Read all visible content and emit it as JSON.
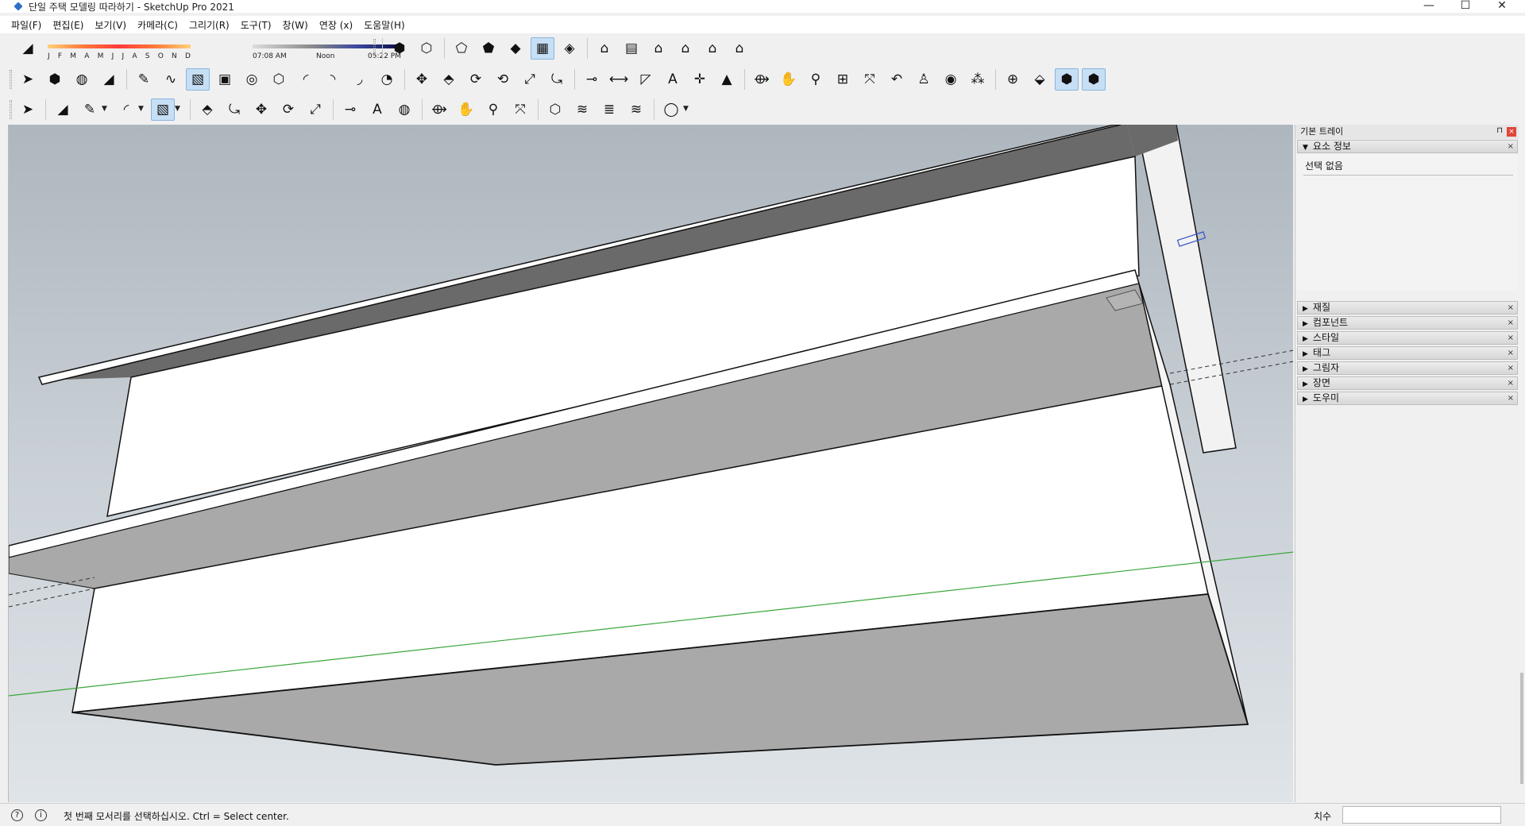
{
  "window": {
    "title": "단일 주택 모델링 따라하기 - SketchUp Pro 2021",
    "minimize": "—",
    "maximize": "☐",
    "close": "✕"
  },
  "menu": [
    "파일(F)",
    "편집(E)",
    "보기(V)",
    "카메라(C)",
    "그리기(R)",
    "도구(T)",
    "창(W)",
    "연장 (x)",
    "도움말(H)"
  ],
  "shadow": {
    "months": [
      "J",
      "F",
      "M",
      "A",
      "M",
      "J",
      "J",
      "A",
      "S",
      "O",
      "N",
      "D"
    ],
    "time_start": "07:08 AM",
    "time_mid": "Noon",
    "time_end": "05:22 PM"
  },
  "toolbar_rows": [
    [
      {
        "name": "eraser-icon",
        "glyph": "◢"
      },
      {
        "name": "xray-style-icon",
        "glyph": "⬢"
      },
      {
        "name": "back-edges-icon",
        "glyph": "⬡"
      },
      {
        "name": "wireframe-icon",
        "glyph": "⬠"
      },
      {
        "name": "hidden-line-icon",
        "glyph": "⬟"
      },
      {
        "name": "shaded-icon",
        "glyph": "◆"
      },
      {
        "name": "shaded-textures-icon",
        "glyph": "▦",
        "active": true
      },
      {
        "name": "monochrome-icon",
        "glyph": "◈"
      },
      {
        "name": "iso-view-icon",
        "glyph": "⌂"
      },
      {
        "name": "top-view-icon",
        "glyph": "▤"
      },
      {
        "name": "front-view-icon",
        "glyph": "⌂"
      },
      {
        "name": "right-view-icon",
        "glyph": "⌂"
      },
      {
        "name": "back-view-icon",
        "glyph": "⌂"
      },
      {
        "name": "left-view-icon",
        "glyph": "⌂"
      }
    ],
    [
      {
        "name": "select-icon",
        "glyph": "➤"
      },
      {
        "name": "component-icon",
        "glyph": "⬢"
      },
      {
        "name": "paint-bucket-icon",
        "glyph": "◍"
      },
      {
        "name": "eraser-icon",
        "glyph": "◢"
      },
      {
        "name": "pencil-icon",
        "glyph": "✎"
      },
      {
        "name": "freehand-icon",
        "glyph": "∿"
      },
      {
        "name": "rectangle-icon",
        "glyph": "▧",
        "active": true
      },
      {
        "name": "rotated-rect-icon",
        "glyph": "▣"
      },
      {
        "name": "circle-icon",
        "glyph": "◎"
      },
      {
        "name": "polygon-icon",
        "glyph": "⬡"
      },
      {
        "name": "arc-icon",
        "glyph": "◜"
      },
      {
        "name": "arc2-icon",
        "glyph": "◝"
      },
      {
        "name": "arc3-icon",
        "glyph": "◞"
      },
      {
        "name": "pie-icon",
        "glyph": "◔"
      },
      {
        "name": "move-icon",
        "glyph": "✥"
      },
      {
        "name": "push-pull-icon",
        "glyph": "⬘"
      },
      {
        "name": "rotate-icon",
        "glyph": "⟳"
      },
      {
        "name": "follow-me-icon",
        "glyph": "⟲"
      },
      {
        "name": "scale-icon",
        "glyph": "⤢"
      },
      {
        "name": "offset-icon",
        "glyph": "⤿"
      },
      {
        "name": "tape-measure-icon",
        "glyph": "⊸"
      },
      {
        "name": "dimension-icon",
        "glyph": "⟷"
      },
      {
        "name": "protractor-icon",
        "glyph": "◸"
      },
      {
        "name": "text-icon",
        "glyph": "A"
      },
      {
        "name": "axes-icon",
        "glyph": "✛"
      },
      {
        "name": "3d-text-icon",
        "glyph": "▲"
      },
      {
        "name": "orbit-icon",
        "glyph": "⟴"
      },
      {
        "name": "pan-icon",
        "glyph": "✋"
      },
      {
        "name": "zoom-icon",
        "glyph": "⚲"
      },
      {
        "name": "zoom-window-icon",
        "glyph": "⊞"
      },
      {
        "name": "zoom-extents-icon",
        "glyph": "⤧"
      },
      {
        "name": "previous-icon",
        "glyph": "↶"
      },
      {
        "name": "position-camera-icon",
        "glyph": "♙"
      },
      {
        "name": "look-around-icon",
        "glyph": "◉"
      },
      {
        "name": "walk-icon",
        "glyph": "⁂"
      },
      {
        "name": "section-plane-icon",
        "glyph": "⊕"
      },
      {
        "name": "display-section-icon",
        "glyph": "⬙"
      },
      {
        "name": "section-cuts-icon",
        "glyph": "⬢",
        "active": true
      },
      {
        "name": "section-fill-icon",
        "glyph": "⬢",
        "active": true
      }
    ],
    [
      {
        "name": "select-icon",
        "glyph": "➤"
      },
      {
        "name": "eraser-icon",
        "glyph": "◢"
      },
      {
        "name": "pencil-icon",
        "glyph": "✎",
        "dd": true
      },
      {
        "name": "arc-icon",
        "glyph": "◜",
        "dd": true
      },
      {
        "name": "rectangle-icon",
        "glyph": "▧",
        "dd": true,
        "active": true
      },
      {
        "name": "push-pull-icon",
        "glyph": "⬘"
      },
      {
        "name": "offset-icon",
        "glyph": "⤿"
      },
      {
        "name": "move-icon",
        "glyph": "✥"
      },
      {
        "name": "rotate-icon",
        "glyph": "⟳"
      },
      {
        "name": "scale-icon",
        "glyph": "⤢"
      },
      {
        "name": "tape-measure-icon",
        "glyph": "⊸"
      },
      {
        "name": "text-icon",
        "glyph": "A"
      },
      {
        "name": "paint-bucket-icon",
        "glyph": "◍"
      },
      {
        "name": "orbit-icon",
        "glyph": "⟴"
      },
      {
        "name": "pan-icon",
        "glyph": "✋"
      },
      {
        "name": "zoom-icon",
        "glyph": "⚲"
      },
      {
        "name": "zoom-extents-icon",
        "glyph": "⤧"
      },
      {
        "name": "warehouse-icon",
        "glyph": "⬡"
      },
      {
        "name": "extension-warehouse-icon",
        "glyph": "≋"
      },
      {
        "name": "layers-icon",
        "glyph": "≣"
      },
      {
        "name": "extension-manager-icon",
        "glyph": "≋"
      },
      {
        "name": "account-icon",
        "glyph": "◯",
        "dd": true
      }
    ]
  ],
  "tray": {
    "title": "기본 트레이",
    "pin": "⊓",
    "close": "×",
    "entity_info": {
      "label": "요소 정보",
      "content": "선택 없음"
    },
    "panels": [
      "재질",
      "컴포넌트",
      "스타일",
      "태그",
      "그림자",
      "장면",
      "도우미"
    ]
  },
  "status": {
    "geo_icon": "?",
    "info_icon": "i",
    "message": "첫 번째 모서리를 선택하십시오. Ctrl = Select center.",
    "measure_label": "치수",
    "measure_value": ""
  },
  "colors": {
    "active_tool": "#c7dff5",
    "face_white": "#ffffff",
    "face_gray": "#a9a9a9",
    "face_dark": "#6a6a6a",
    "axis_green": "#3aa53a"
  }
}
